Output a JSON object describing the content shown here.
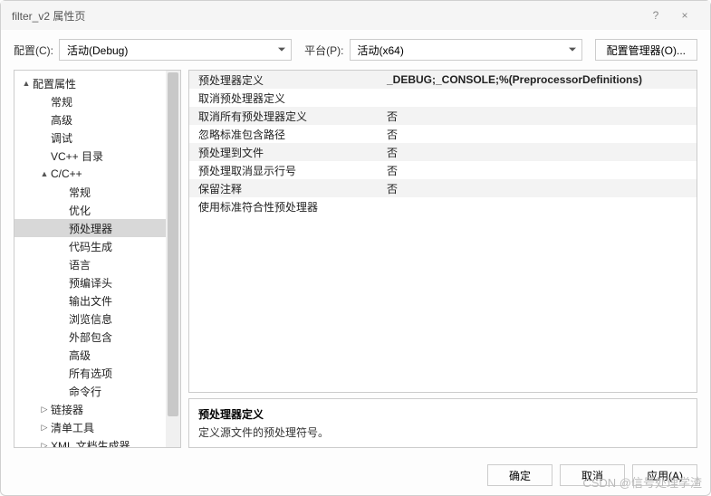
{
  "window": {
    "title": "filter_v2 属性页",
    "help": "?",
    "close": "×"
  },
  "configRow": {
    "configLabel": "配置(C):",
    "configValue": "活动(Debug)",
    "platformLabel": "平台(P):",
    "platformValue": "活动(x64)",
    "managerBtn": "配置管理器(O)..."
  },
  "tree": [
    {
      "label": "配置属性",
      "depth": 0,
      "expand": "▲"
    },
    {
      "label": "常规",
      "depth": 1,
      "expand": ""
    },
    {
      "label": "高级",
      "depth": 1,
      "expand": ""
    },
    {
      "label": "调试",
      "depth": 1,
      "expand": ""
    },
    {
      "label": "VC++ 目录",
      "depth": 1,
      "expand": ""
    },
    {
      "label": "C/C++",
      "depth": 1,
      "expand": "▲"
    },
    {
      "label": "常规",
      "depth": 2,
      "expand": ""
    },
    {
      "label": "优化",
      "depth": 2,
      "expand": ""
    },
    {
      "label": "预处理器",
      "depth": 2,
      "expand": "",
      "selected": true
    },
    {
      "label": "代码生成",
      "depth": 2,
      "expand": ""
    },
    {
      "label": "语言",
      "depth": 2,
      "expand": ""
    },
    {
      "label": "预编译头",
      "depth": 2,
      "expand": ""
    },
    {
      "label": "输出文件",
      "depth": 2,
      "expand": ""
    },
    {
      "label": "浏览信息",
      "depth": 2,
      "expand": ""
    },
    {
      "label": "外部包含",
      "depth": 2,
      "expand": ""
    },
    {
      "label": "高级",
      "depth": 2,
      "expand": ""
    },
    {
      "label": "所有选项",
      "depth": 2,
      "expand": ""
    },
    {
      "label": "命令行",
      "depth": 2,
      "expand": ""
    },
    {
      "label": "链接器",
      "depth": 1,
      "expand": "▷"
    },
    {
      "label": "清单工具",
      "depth": 1,
      "expand": "▷"
    },
    {
      "label": "XML 文档生成器",
      "depth": 1,
      "expand": "▷"
    }
  ],
  "props": [
    {
      "name": "预处理器定义",
      "value": "_DEBUG;_CONSOLE;%(PreprocessorDefinitions)",
      "selected": true
    },
    {
      "name": "取消预处理器定义",
      "value": ""
    },
    {
      "name": "取消所有预处理器定义",
      "value": "否"
    },
    {
      "name": "忽略标准包含路径",
      "value": "否"
    },
    {
      "name": "预处理到文件",
      "value": "否"
    },
    {
      "name": "预处理取消显示行号",
      "value": "否"
    },
    {
      "name": "保留注释",
      "value": "否"
    },
    {
      "name": "使用标准符合性预处理器",
      "value": ""
    }
  ],
  "desc": {
    "title": "预处理器定义",
    "text": "定义源文件的预处理符号。"
  },
  "footer": {
    "ok": "确定",
    "cancel": "取消",
    "apply": "应用(A)"
  },
  "watermark": "CSDN @信号处理学渣"
}
